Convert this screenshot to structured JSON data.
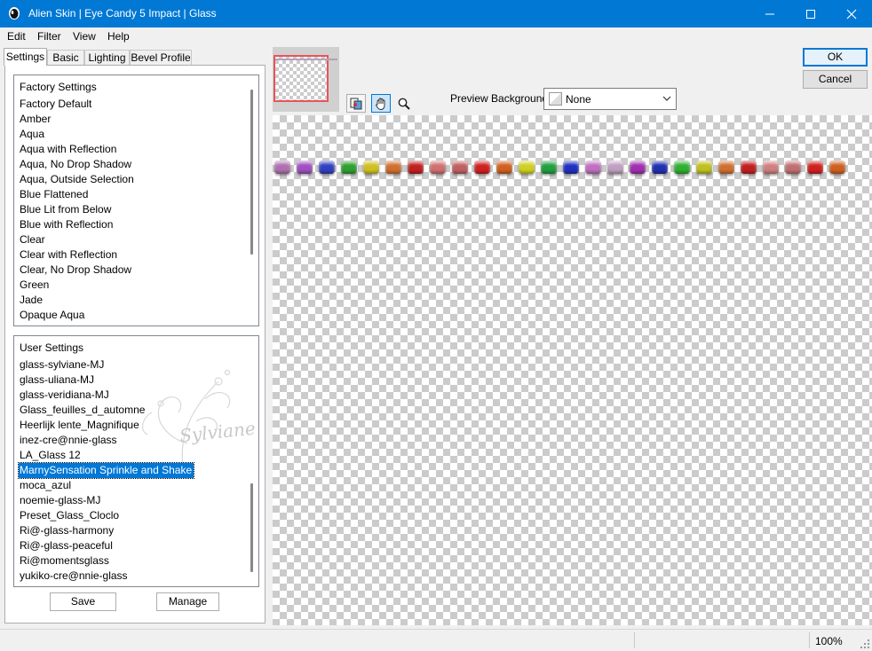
{
  "window": {
    "title": "Alien Skin | Eye Candy 5 Impact | Glass"
  },
  "menu": [
    "Edit",
    "Filter",
    "View",
    "Help"
  ],
  "tabs": [
    "Settings",
    "Basic",
    "Lighting",
    "Bevel Profile"
  ],
  "factory": {
    "header": "Factory Settings",
    "items": [
      "Factory Default",
      "Amber",
      "Aqua",
      "Aqua with Reflection",
      "Aqua, No Drop Shadow",
      "Aqua, Outside Selection",
      "Blue Flattened",
      "Blue Lit from Below",
      "Blue with Reflection",
      "Clear",
      "Clear with Reflection",
      "Clear, No Drop Shadow",
      "Green",
      "Jade",
      "Opaque Aqua"
    ]
  },
  "user": {
    "header": "User Settings",
    "items": [
      "glass-sylviane-MJ",
      "glass-uliana-MJ",
      "glass-veridiana-MJ",
      "Glass_feuilles_d_automne",
      "Heerlijk lente_Magnifique",
      "inez-cre@nnie-glass",
      "LA_Glass 12",
      "MarnySensation Sprinkle and Shake",
      "moca_azul",
      "noemie-glass-MJ",
      "Preset_Glass_Cloclo",
      "Ri@-glass-harmony",
      "Ri@-glass-peaceful",
      "Ri@momentsglass",
      "yukiko-cre@nnie-glass"
    ],
    "selected_index": 7
  },
  "watermark": {
    "text": "Sylviane"
  },
  "buttons": {
    "save": "Save",
    "manage": "Manage",
    "ok": "OK",
    "cancel": "Cancel"
  },
  "preview_background": {
    "label": "Preview Background:",
    "value": "None"
  },
  "status": {
    "zoom": "100%"
  },
  "bead_colors": [
    "#b070b0",
    "#a050c0",
    "#3040c0",
    "#30a030",
    "#d0c020",
    "#d07030",
    "#c02020",
    "#d07070",
    "#c06060",
    "#d02020",
    "#d06020",
    "#d0d020",
    "#20a040",
    "#2030c0",
    "#c070c0",
    "#c0a0c0",
    "#a030b0",
    "#2030b0",
    "#30b030",
    "#c0c020",
    "#d07030",
    "#c02020",
    "#d08080",
    "#c07070",
    "#d02020",
    "#d06020"
  ]
}
